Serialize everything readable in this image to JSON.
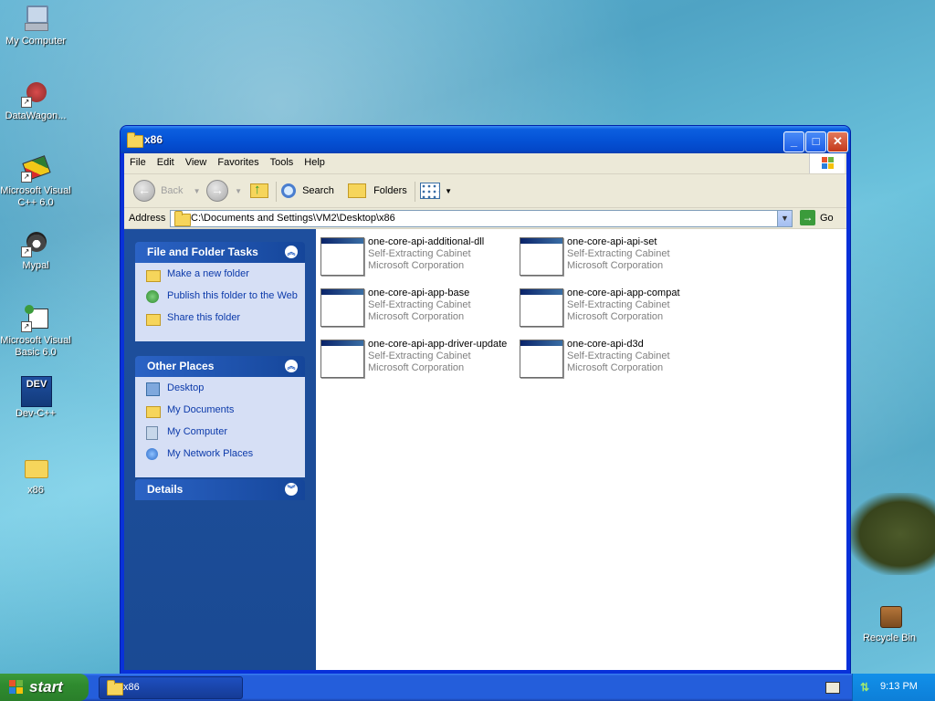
{
  "desktop": {
    "icons": [
      {
        "label": "My Computer",
        "icon": "my-computer-icon"
      },
      {
        "label": "DataWagon...",
        "icon": "datawagon-icon"
      },
      {
        "label": "Microsoft Visual C++ 6.0",
        "icon": "visual-cpp-icon"
      },
      {
        "label": "Mypal",
        "icon": "mypal-icon"
      },
      {
        "label": "Microsoft Visual Basic 6.0",
        "icon": "visual-basic-icon"
      },
      {
        "label": "Dev-C++",
        "icon": "dev-cpp-icon"
      },
      {
        "label": "x86",
        "icon": "folder-icon"
      },
      {
        "label": "Recycle Bin",
        "icon": "recycle-bin-icon"
      }
    ]
  },
  "window": {
    "title": "x86",
    "menu": [
      "File",
      "Edit",
      "View",
      "Favorites",
      "Tools",
      "Help"
    ],
    "toolbar": {
      "back": "Back",
      "search": "Search",
      "folders": "Folders"
    },
    "address": {
      "label": "Address",
      "value": "C:\\Documents and Settings\\VM2\\Desktop\\x86",
      "go": "Go"
    },
    "taskpane": {
      "file_tasks": {
        "title": "File and Folder Tasks",
        "links": [
          "Make a new folder",
          "Publish this folder to the Web",
          "Share this folder"
        ]
      },
      "other_places": {
        "title": "Other Places",
        "links": [
          "Desktop",
          "My Documents",
          "My Computer",
          "My Network Places"
        ]
      },
      "details": {
        "title": "Details"
      }
    },
    "files": [
      {
        "name": "one-core-api-additional-dll",
        "type": "Self-Extracting Cabinet",
        "company": "Microsoft Corporation"
      },
      {
        "name": "one-core-api-api-set",
        "type": "Self-Extracting Cabinet",
        "company": "Microsoft Corporation"
      },
      {
        "name": "one-core-api-app-base",
        "type": "Self-Extracting Cabinet",
        "company": "Microsoft Corporation"
      },
      {
        "name": "one-core-api-app-compat",
        "type": "Self-Extracting Cabinet",
        "company": "Microsoft Corporation"
      },
      {
        "name": "one-core-api-app-driver-update",
        "type": "Self-Extracting Cabinet",
        "company": "Microsoft Corporation"
      },
      {
        "name": "one-core-api-d3d",
        "type": "Self-Extracting Cabinet",
        "company": "Microsoft Corporation"
      }
    ]
  },
  "taskbar": {
    "start": "start",
    "task": "x86",
    "clock": "9:13 PM"
  },
  "colors": {
    "title_blue": "#0553d6",
    "link_blue": "#0c3aaa",
    "start_green": "#2f8b2f"
  }
}
